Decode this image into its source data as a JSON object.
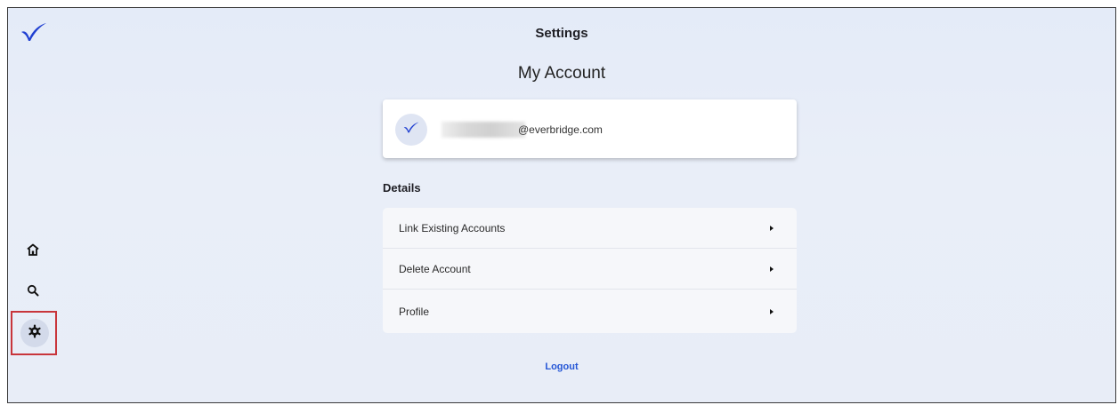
{
  "header": {
    "title": "Settings"
  },
  "page": {
    "title": "My Account"
  },
  "sidebar": {
    "logo_icon": "checkmark-bird-logo-icon",
    "items": [
      {
        "icon": "home-icon",
        "selected": false
      },
      {
        "icon": "search-icon",
        "selected": false
      },
      {
        "icon": "gear-icon",
        "selected": true
      }
    ]
  },
  "account": {
    "avatar_icon": "checkmark-bird-logo-icon",
    "email_domain": "@everbridge.com"
  },
  "details": {
    "heading": "Details",
    "items": [
      {
        "label": "Link Existing Accounts",
        "icon": "caret-right-icon"
      },
      {
        "label": "Delete Account",
        "icon": "caret-right-icon"
      },
      {
        "label": "Profile",
        "icon": "caret-right-icon"
      }
    ]
  },
  "logout_label": "Logout",
  "colors": {
    "brand": "#1f3fd1",
    "link": "#2556d6",
    "highlight_border": "#c8353b",
    "background": "#e8edf7"
  }
}
